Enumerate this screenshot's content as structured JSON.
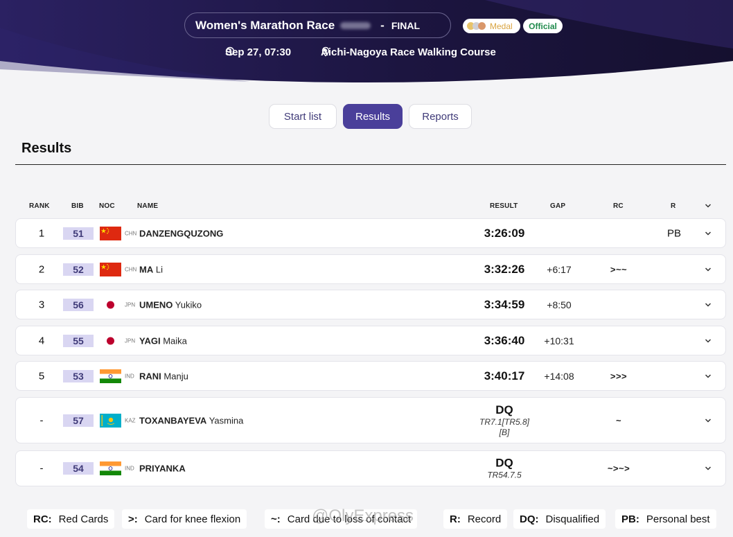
{
  "header": {
    "title": "Women's Marathon Race",
    "separator": "-",
    "phase": "FINAL",
    "medal_badge": "Medal",
    "official_badge": "Official",
    "datetime": "Sep 27, 07:30",
    "venue": "Aichi-Nagoya Race Walking Course",
    "colors": {
      "bg_dark": "#1c1540",
      "bg_accent": "#3a2c7a",
      "gold": "#e8c36a",
      "silver": "#cfcfd6",
      "bronze": "#d9976a",
      "official": "#1f8a4c"
    }
  },
  "tabs": [
    {
      "label": "Start list",
      "active": false
    },
    {
      "label": "Results",
      "active": true
    },
    {
      "label": "Reports",
      "active": false
    }
  ],
  "section_title": "Results",
  "columns": {
    "rank": "RANK",
    "bib": "BIB",
    "noc": "NOC",
    "name": "NAME",
    "result": "RESULT",
    "gap": "GAP",
    "rc": "RC",
    "r": "R"
  },
  "rows": [
    {
      "rank": "1",
      "bib": "51",
      "noc": "CHN",
      "flag": "cn",
      "surname": "DANZENGQUZONG",
      "given": "",
      "result": "3:26:09",
      "gap": "",
      "rc": "",
      "r": "PB"
    },
    {
      "rank": "2",
      "bib": "52",
      "noc": "CHN",
      "flag": "cn",
      "surname": "MA",
      "given": "Li",
      "result": "3:32:26",
      "gap": "+6:17",
      "rc": ">~~",
      "r": ""
    },
    {
      "rank": "3",
      "bib": "56",
      "noc": "JPN",
      "flag": "jp",
      "surname": "UMENO",
      "given": "Yukiko",
      "result": "3:34:59",
      "gap": "+8:50",
      "rc": "",
      "r": ""
    },
    {
      "rank": "4",
      "bib": "55",
      "noc": "JPN",
      "flag": "jp",
      "surname": "YAGI",
      "given": "Maika",
      "result": "3:36:40",
      "gap": "+10:31",
      "rc": "",
      "r": ""
    },
    {
      "rank": "5",
      "bib": "53",
      "noc": "IND",
      "flag": "in",
      "surname": "RANI",
      "given": "Manju",
      "result": "3:40:17",
      "gap": "+14:08",
      "rc": ">>>",
      "r": ""
    },
    {
      "rank": "-",
      "bib": "57",
      "noc": "KAZ",
      "flag": "kz",
      "surname": "TOXANBAYEVA",
      "given": "Yasmina",
      "result": "DQ",
      "note1": "TR7.1[TR5.8]",
      "note2": "[B]",
      "gap": "",
      "rc": "~",
      "r": ""
    },
    {
      "rank": "-",
      "bib": "54",
      "noc": "IND",
      "flag": "in",
      "surname": "PRIYANKA",
      "given": "",
      "result": "DQ",
      "note1": "TR54.7.5",
      "gap": "",
      "rc": "~>~>",
      "r": ""
    }
  ],
  "legend": [
    {
      "key": "RC:",
      "text": "Red Cards"
    },
    {
      "key": ">:",
      "text": "Card for knee flexion"
    },
    {
      "key": "~:",
      "text": "Card due to loss of contact"
    },
    {
      "key": "R:",
      "text": "Record"
    },
    {
      "key": "DQ:",
      "text": "Disqualified"
    },
    {
      "key": "PB:",
      "text": "Personal best"
    }
  ],
  "watermark": "@OlyExpress"
}
